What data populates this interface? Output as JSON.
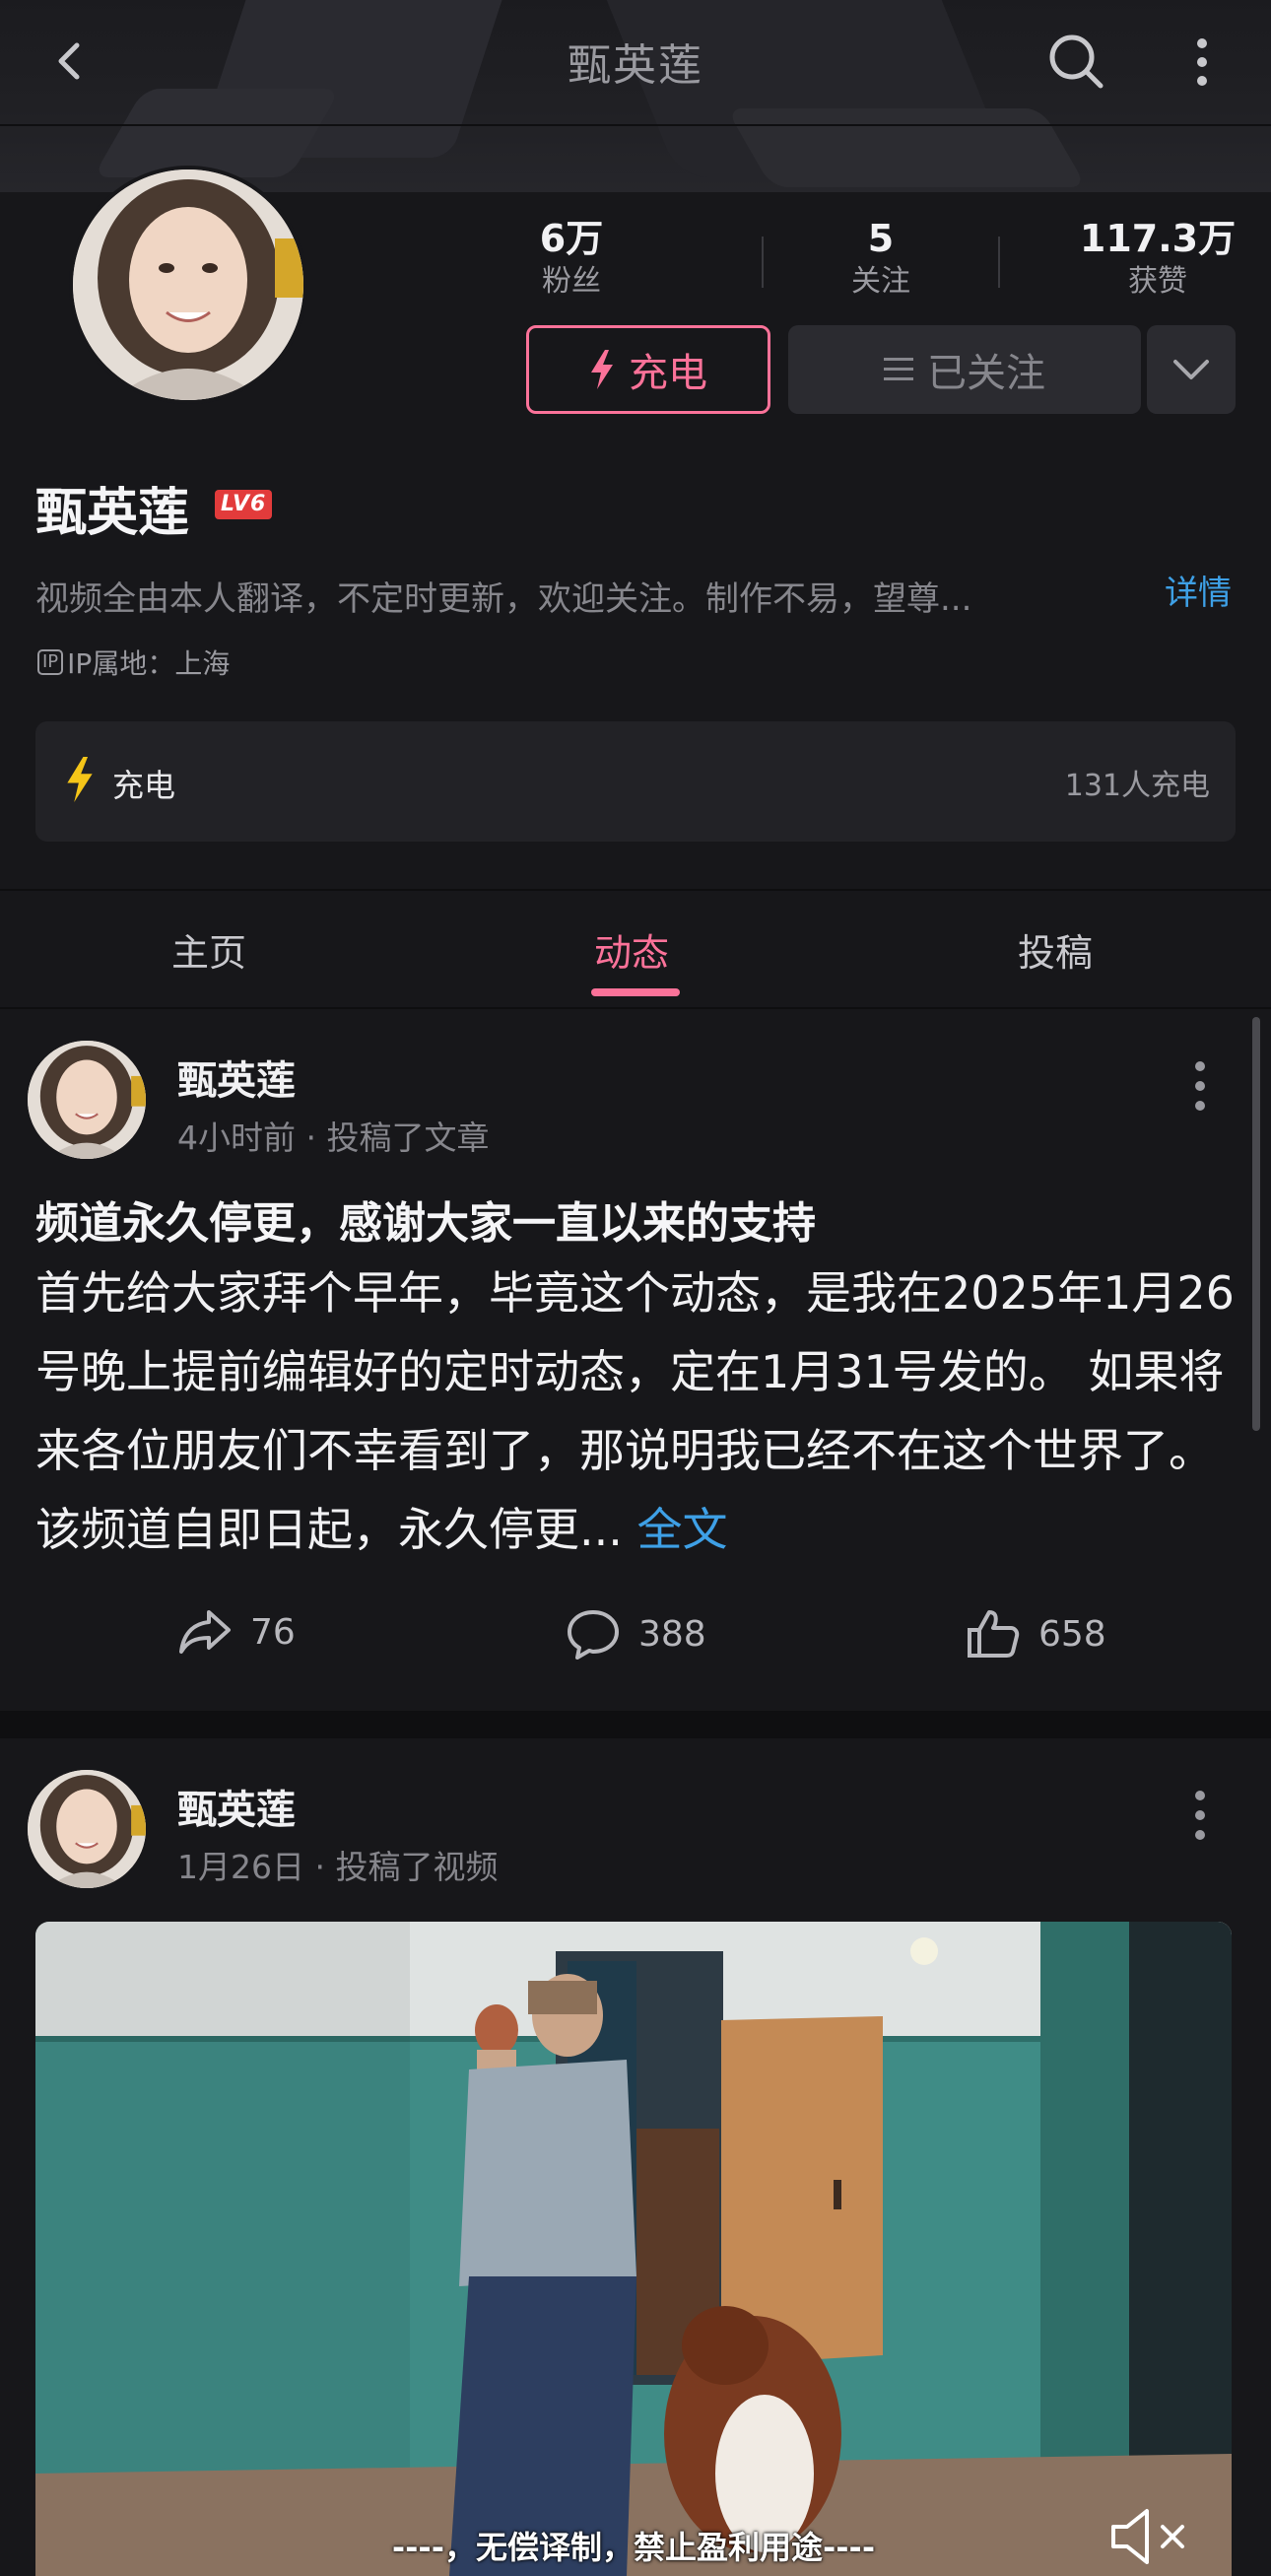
{
  "header": {
    "title": "甄英莲"
  },
  "profile": {
    "stats": [
      {
        "value": "6万",
        "label": "粉丝"
      },
      {
        "value": "5",
        "label": "关注"
      },
      {
        "value": "117.3万",
        "label": "获赞"
      }
    ],
    "charge_button": "充电",
    "followed_button": "已关注",
    "name": "甄英莲",
    "level": "LV6",
    "bio": "视频全由本人翻译，不定时更新，欢迎关注。制作不易，望尊...",
    "details_link": "详情",
    "ip_label": "IP",
    "ip_location": "IP属地：上海",
    "charge_card": {
      "label": "充电",
      "count": "131人充电"
    }
  },
  "tabs": [
    {
      "label": "主页"
    },
    {
      "label": "动态"
    },
    {
      "label": "投稿"
    }
  ],
  "posts": [
    {
      "author": "甄英莲",
      "meta": "4小时前 · 投稿了文章",
      "title": "频道永久停更，感谢大家一直以来的支持",
      "body": "首先给大家拜个早年，毕竟这个动态，是我在2025年1月26号晚上提前编辑好的定时动态，定在1月31号发的。 如果将来各位朋友们不幸看到了，那说明我已经不在这个世界了。 该频道自即日起，永久停更...",
      "more_link": "全文",
      "shares": "76",
      "comments": "388",
      "likes": "658"
    },
    {
      "author": "甄英莲",
      "meta": "1月26日 · 投稿了视频",
      "video_subtitle": "----，无偿译制，禁止盈利用途----"
    }
  ],
  "colors": {
    "accent_pink": "#fb7299",
    "link_blue": "#3ea0e6",
    "bolt_yellow": "#f5c518",
    "background": "#17171a"
  }
}
